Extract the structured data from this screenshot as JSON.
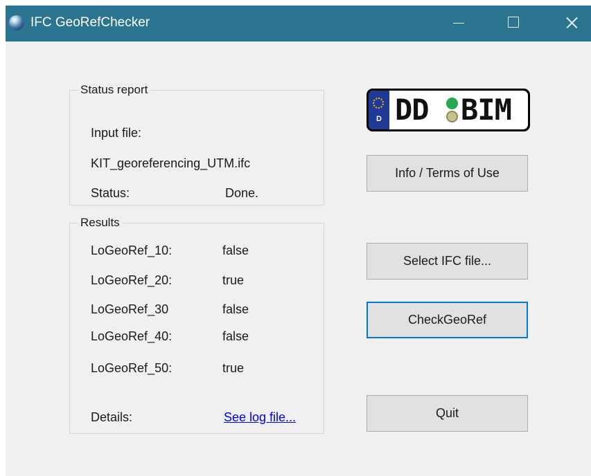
{
  "window": {
    "title": "IFC GeoRefChecker"
  },
  "status_report": {
    "legend": "Status report",
    "input_file_label": "Input file:",
    "input_file_value": "KIT_georeferencing_UTM.ifc",
    "status_label": "Status:",
    "status_value": "Done."
  },
  "results": {
    "legend": "Results",
    "rows": [
      {
        "label": "LoGeoRef_10:",
        "value": "false"
      },
      {
        "label": "LoGeoRef_20:",
        "value": "true"
      },
      {
        "label": "LoGeoRef_30",
        "value": "false"
      },
      {
        "label": "LoGeoRef_40:",
        "value": "false"
      },
      {
        "label": "LoGeoRef_50:",
        "value": "true"
      }
    ],
    "details_label": "Details:",
    "details_link": "See log file..."
  },
  "logo": {
    "left_text": "DD",
    "right_text": "BIM",
    "country_code": "D"
  },
  "buttons": {
    "info": "Info / Terms of Use",
    "select": "Select IFC file...",
    "check": "CheckGeoRef",
    "quit": "Quit"
  },
  "colors": {
    "titlebar": "#2b7590",
    "window_bg": "#f0f0f0",
    "button_bg": "#e1e1e1",
    "focus_border": "#0078d7",
    "link": "#0000ee"
  }
}
